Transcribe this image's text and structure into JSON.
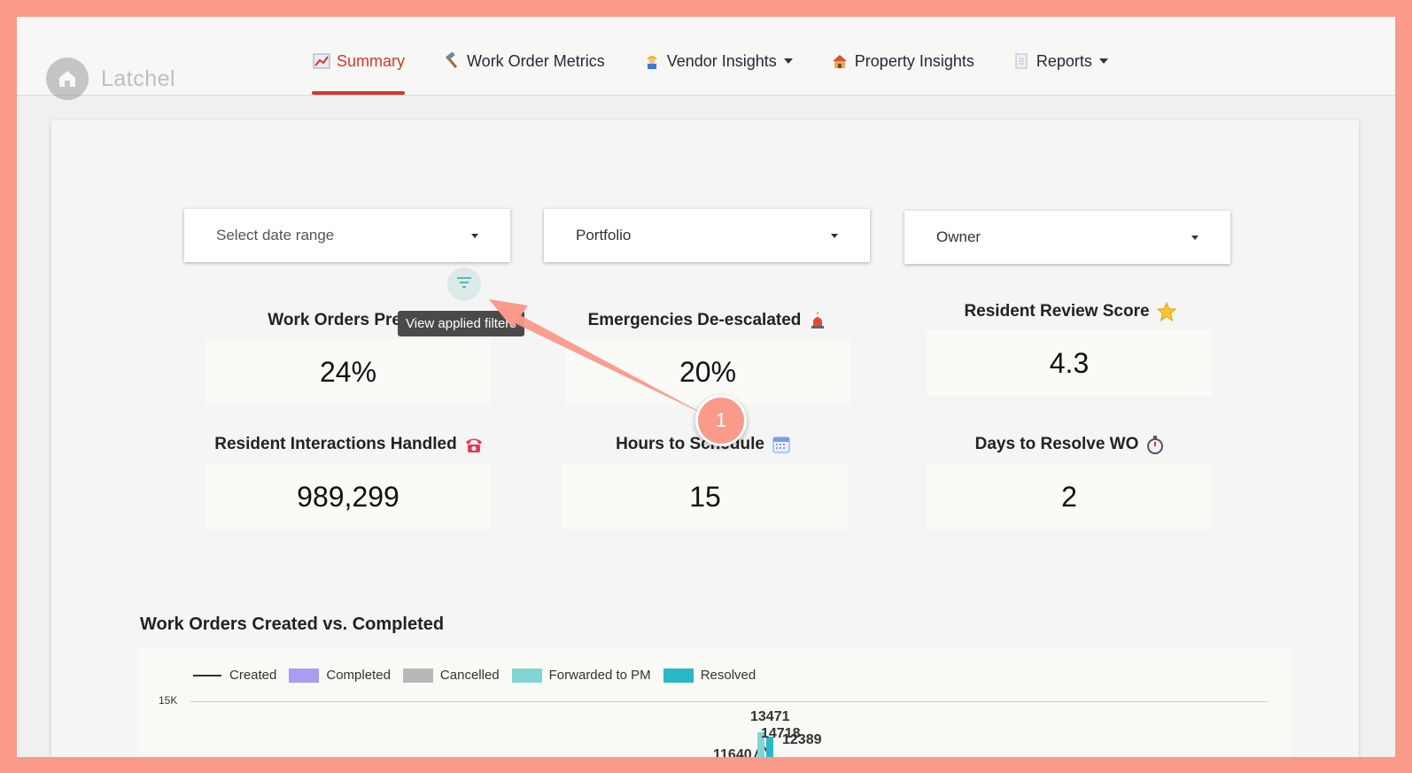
{
  "app": {
    "logo_text": "Latchel"
  },
  "nav": {
    "items": [
      {
        "label": "Summary",
        "icon": "chart-increasing-icon",
        "active": true,
        "dropdown": false
      },
      {
        "label": "Work Order Metrics",
        "icon": "hammer-icon",
        "active": false,
        "dropdown": false
      },
      {
        "label": "Vendor Insights",
        "icon": "construction-worker-icon",
        "active": false,
        "dropdown": true
      },
      {
        "label": "Property Insights",
        "icon": "house-icon",
        "active": false,
        "dropdown": false
      },
      {
        "label": "Reports",
        "icon": "document-icon",
        "active": false,
        "dropdown": true
      }
    ]
  },
  "filters": {
    "date_range": {
      "placeholder": "Select date range"
    },
    "portfolio": {
      "value": "Portfolio"
    },
    "owner": {
      "value": "Owner"
    },
    "view_filters_tooltip": "View applied filters"
  },
  "metrics": [
    {
      "title": "Work Orders Preven",
      "value": "24%",
      "icon": ""
    },
    {
      "title": "Emergencies De-escalated",
      "value": "20%",
      "icon": "siren-icon"
    },
    {
      "title": "Resident Review Score",
      "value": "4.3",
      "icon": "star-icon"
    },
    {
      "title": "Resident Interactions Handled",
      "value": "989,299",
      "icon": "telephone-icon"
    },
    {
      "title": "Hours to Schedule",
      "value": "15",
      "icon": "calendar-icon"
    },
    {
      "title": "Days to Resolve WO",
      "value": "2",
      "icon": "stopwatch-icon"
    }
  ],
  "annotation": {
    "badge": "1"
  },
  "colors": {
    "accent": "#d9352b",
    "frame": "#f99a8a",
    "completed": "#a99cf2",
    "cancelled": "#b8b8b8",
    "forwarded": "#80d6d4",
    "resolved": "#2ab7c6"
  },
  "chart_data": {
    "type": "line",
    "title": "Work Orders Created vs. Completed",
    "legend": [
      "Created",
      "Completed",
      "Cancelled",
      "Forwarded to PM",
      "Resolved"
    ],
    "y_ticks": [
      "15K"
    ],
    "data_labels": [
      "13471",
      "14718",
      "12389",
      "11640"
    ],
    "legend_position": "top-left"
  }
}
